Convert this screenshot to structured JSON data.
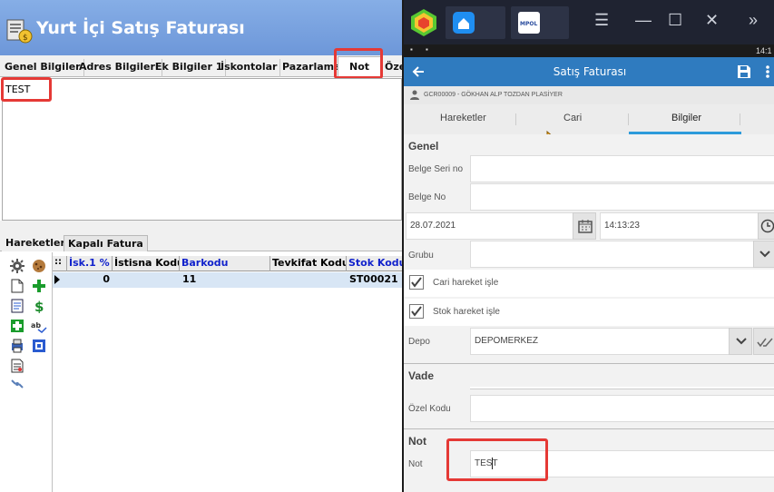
{
  "window": {
    "title": "Yurt İçi Satış Faturası"
  },
  "tabs": [
    {
      "label": "Genel Bilgiler"
    },
    {
      "label": "Adres Bilgileri"
    },
    {
      "label": "Ek Bilgiler 1"
    },
    {
      "label": "İskontolar"
    },
    {
      "label": "Pazarlama"
    },
    {
      "label": "Not"
    },
    {
      "label": "Öze"
    }
  ],
  "note": {
    "text": "TEST"
  },
  "bottom_tabs": [
    {
      "label": "Hareketler"
    },
    {
      "label": "Kapalı Fatura"
    }
  ],
  "grid": {
    "corner": "::",
    "headers": [
      {
        "label": "İsk.1 %",
        "blue": true
      },
      {
        "label": "İstisna Kodu",
        "blue": false
      },
      {
        "label": "Barkodu",
        "blue": true
      },
      {
        "label": "Tevkifat Kodu",
        "blue": false
      },
      {
        "label": "Stok Kodu",
        "blue": true
      }
    ],
    "row": {
      "isk1": "0",
      "istisna": "",
      "barkod": "11",
      "tevkifat": "",
      "stok": "ST00021"
    }
  },
  "emulator": {
    "status_time": "14:1",
    "app_logo_text": "MPOL"
  },
  "mobile": {
    "title": "Satış Faturası",
    "user": "GCR00009 - GÖKHAN ALP TOZDAN PLASİYER",
    "tabs": [
      {
        "label": "Hareketler"
      },
      {
        "label": "Cari"
      },
      {
        "label": "Bilgiler"
      }
    ],
    "sections": {
      "genel": "Genel",
      "vade": "Vade",
      "not": "Not"
    },
    "labels": {
      "belge_seri": "Belge Seri no",
      "belge_no": "Belge No",
      "grubu": "Grubu",
      "cari_hareket": "Cari hareket işle",
      "stok_hareket": "Stok hareket işle",
      "depo": "Depo",
      "ozel_kodu": "Özel Kodu",
      "not_label": "Not"
    },
    "values": {
      "date": "28.07.2021",
      "time": "14:13:23",
      "depo": "DEPOMERKEZ",
      "note": "TEST"
    }
  },
  "icons": {
    "back": "arrow-left-icon",
    "save": "save-icon",
    "more": "more-vert-icon",
    "calendar": "calendar-icon",
    "clock": "clock-icon",
    "dropdown": "chevron-down-icon",
    "check": "check-icon"
  },
  "colors": {
    "titlebar": "#6d97d9",
    "appbar": "#2f7bbf",
    "tab_indicator": "#2d9bdb",
    "highlight": "#e53935",
    "grid_blue_header": "#1122cc"
  }
}
